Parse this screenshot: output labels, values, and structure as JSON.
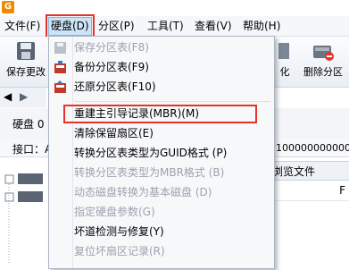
{
  "app": {
    "icon": "G"
  },
  "menubar": {
    "items": [
      "文件(F)",
      "硬盘(D)",
      "分区(P)",
      "工具(T)",
      "查看(V)",
      "帮助(H)"
    ],
    "active_index": 1
  },
  "toolbar": {
    "left_label": "保存更改",
    "right_labels": [
      "化",
      "删除分区"
    ]
  },
  "disk": {
    "label": "硬盘 0",
    "interface_label": "接口：A",
    "number_readout": "10000000000000",
    "tab_files": "浏览文件",
    "column_head_fragment": "F"
  },
  "disk_menu": {
    "items": [
      {
        "label": "保存分区表(F8)",
        "enabled": false,
        "icon": "save-icon"
      },
      {
        "label": "备份分区表(F9)",
        "enabled": true,
        "icon": "backup-icon"
      },
      {
        "label": "还原分区表(F10)",
        "enabled": true,
        "icon": "restore-icon"
      },
      {
        "label": "重建主引导记录(MBR)(M)",
        "enabled": true,
        "icon": "",
        "highlighted": true
      },
      {
        "label": "清除保留扇区(E)",
        "enabled": true,
        "icon": ""
      },
      {
        "label": "转换分区表类型为GUID格式 (P)",
        "enabled": true,
        "icon": ""
      },
      {
        "label": "转换分区表类型为MBR格式 (B)",
        "enabled": false,
        "icon": ""
      },
      {
        "label": "动态磁盘转换为基本磁盘 (D)",
        "enabled": false,
        "icon": ""
      },
      {
        "label": "指定硬盘参数(G)",
        "enabled": false,
        "icon": ""
      },
      {
        "label": "坏道检测与修复(Y)",
        "enabled": true,
        "icon": ""
      },
      {
        "label": "复位坏扇区记录(R)",
        "enabled": false,
        "icon": ""
      }
    ]
  },
  "colors": {
    "accent_red": "#e5332a",
    "menu_active": "#cde4f7",
    "disabled_text": "#9ba3ad"
  }
}
